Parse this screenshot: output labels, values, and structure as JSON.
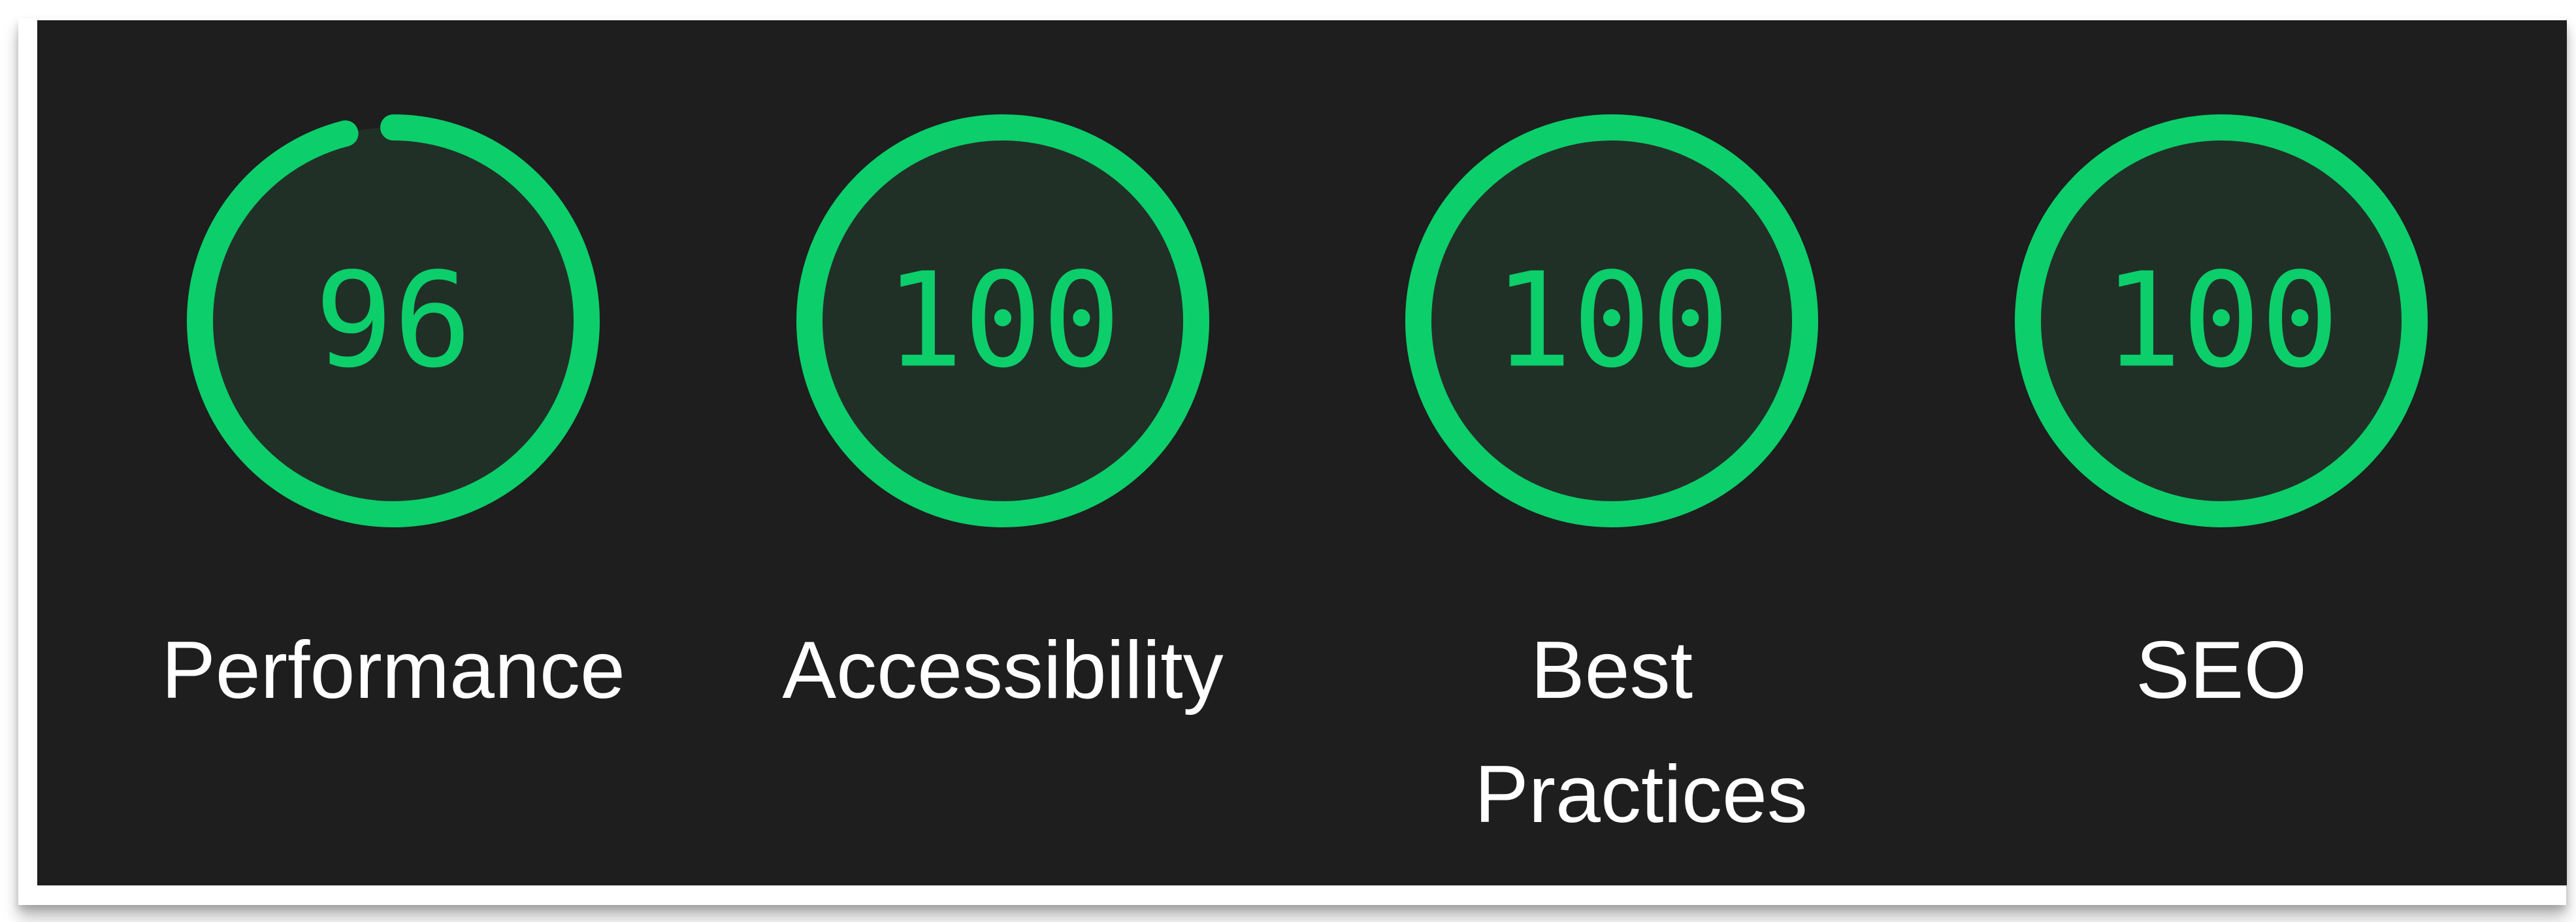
{
  "colors": {
    "panel_background": "#1e1e1e",
    "gauge_fill": "#213026",
    "gauge_pass": "#0cce6b",
    "label_text": "#ffffff"
  },
  "gauges": [
    {
      "label": "Performance",
      "score": "96",
      "value": 96
    },
    {
      "label": "Accessibility",
      "score": "100",
      "value": 100
    },
    {
      "label": "Best Practices",
      "score": "100",
      "value": 100
    },
    {
      "label": "SEO",
      "score": "100",
      "value": 100
    }
  ]
}
